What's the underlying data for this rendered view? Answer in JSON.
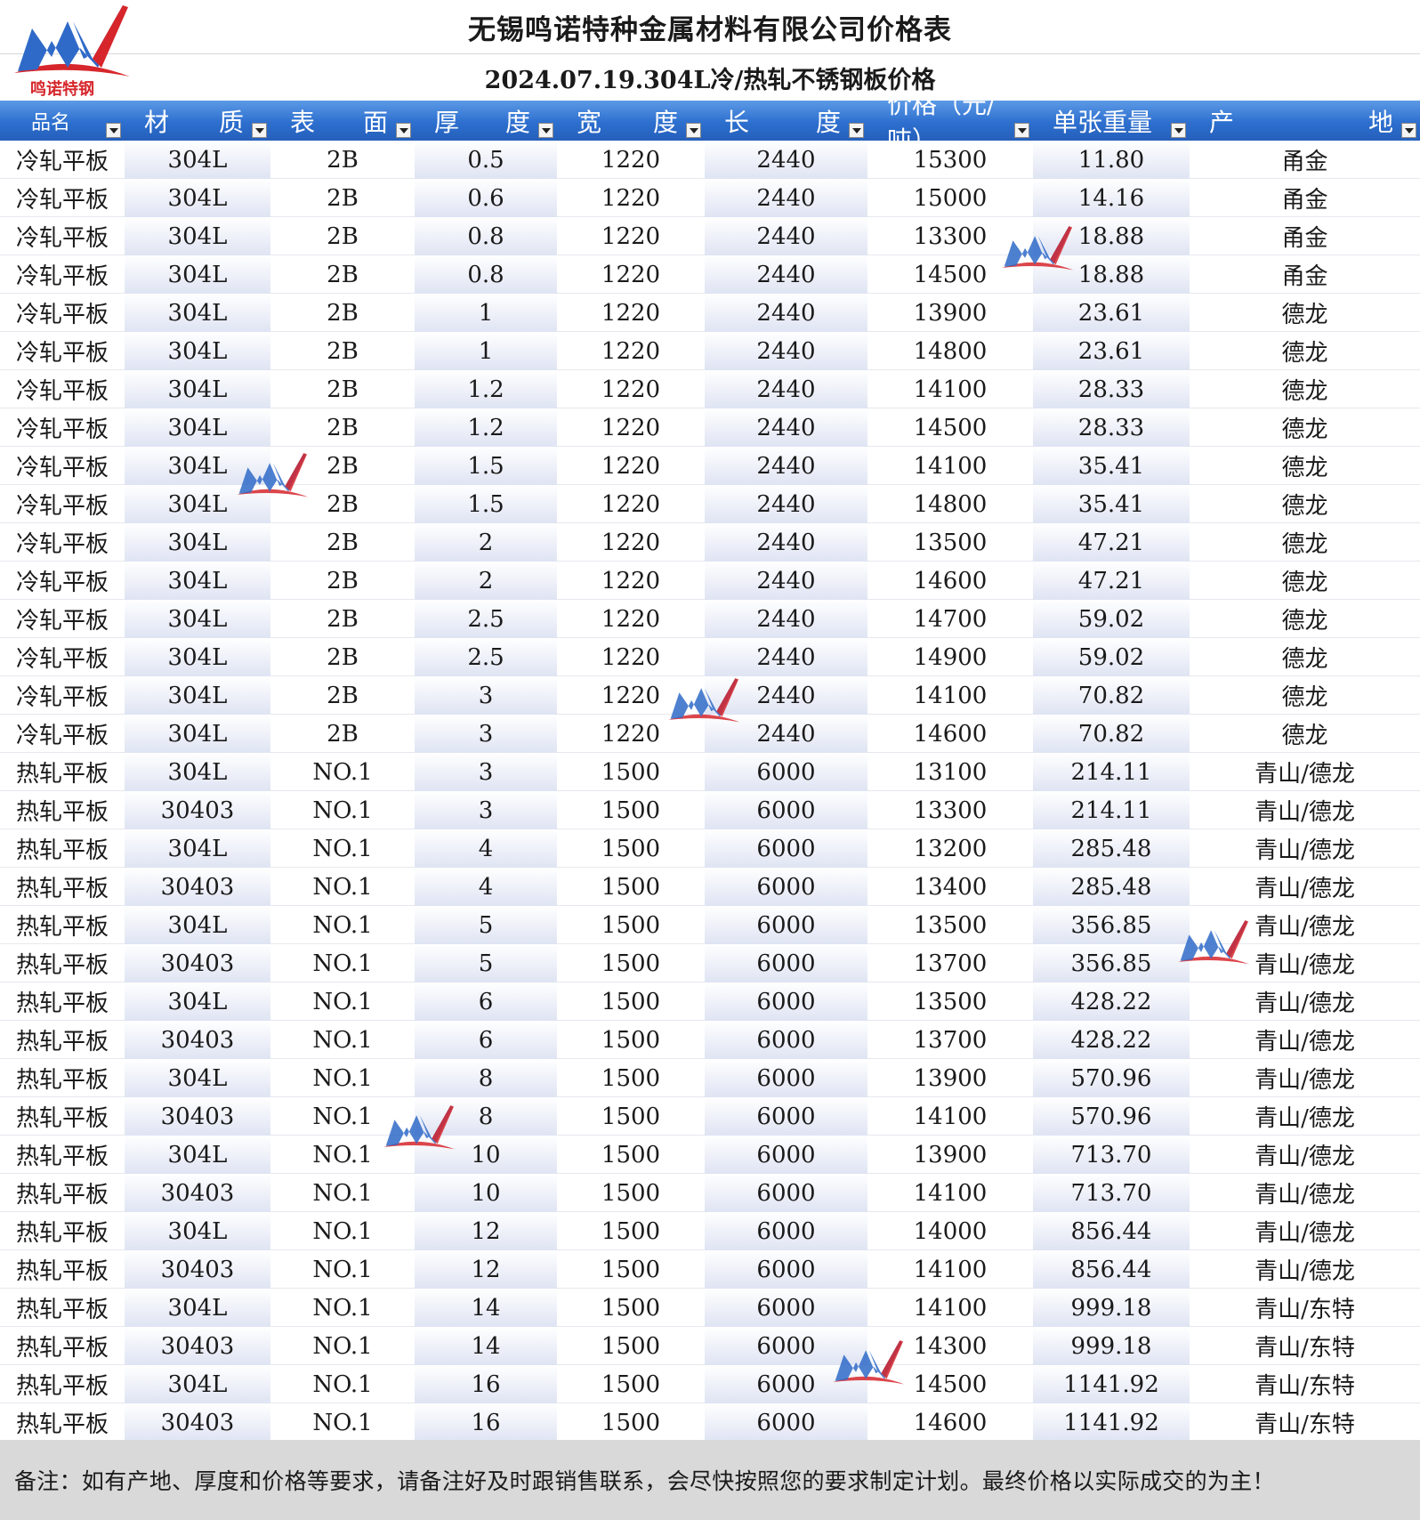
{
  "title": "无锡鸣诺特种金属材料有限公司价格表",
  "subtitle": "2024.07.19.304L冷/热轧不锈钢板价格",
  "logo": {
    "text": "鸣诺特钢",
    "icon": "company-logo-icon",
    "colors": {
      "red": "#d6262b",
      "blue": "#2f6ac8"
    }
  },
  "header_color": "#2d6fcf",
  "headers": [
    {
      "a": "品名",
      "b": ""
    },
    {
      "a": "材",
      "b": "质"
    },
    {
      "a": "表",
      "b": "面"
    },
    {
      "a": "厚",
      "b": "度"
    },
    {
      "a": "宽",
      "b": "度"
    },
    {
      "a": "长",
      "b": "度"
    },
    {
      "a": "价格（元/吨）",
      "b": ""
    },
    {
      "a": "单张重量",
      "b": ""
    },
    {
      "a": "产",
      "b": "地"
    }
  ],
  "rows": [
    [
      "冷轧平板",
      "304L",
      "2B",
      "0.5",
      "1220",
      "2440",
      "15300",
      "11.80",
      "甬金"
    ],
    [
      "冷轧平板",
      "304L",
      "2B",
      "0.6",
      "1220",
      "2440",
      "15000",
      "14.16",
      "甬金"
    ],
    [
      "冷轧平板",
      "304L",
      "2B",
      "0.8",
      "1220",
      "2440",
      "13300",
      "18.88",
      "甬金"
    ],
    [
      "冷轧平板",
      "304L",
      "2B",
      "0.8",
      "1220",
      "2440",
      "14500",
      "18.88",
      "甬金"
    ],
    [
      "冷轧平板",
      "304L",
      "2B",
      "1",
      "1220",
      "2440",
      "13900",
      "23.61",
      "德龙"
    ],
    [
      "冷轧平板",
      "304L",
      "2B",
      "1",
      "1220",
      "2440",
      "14800",
      "23.61",
      "德龙"
    ],
    [
      "冷轧平板",
      "304L",
      "2B",
      "1.2",
      "1220",
      "2440",
      "14100",
      "28.33",
      "德龙"
    ],
    [
      "冷轧平板",
      "304L",
      "2B",
      "1.2",
      "1220",
      "2440",
      "14500",
      "28.33",
      "德龙"
    ],
    [
      "冷轧平板",
      "304L",
      "2B",
      "1.5",
      "1220",
      "2440",
      "14100",
      "35.41",
      "德龙"
    ],
    [
      "冷轧平板",
      "304L",
      "2B",
      "1.5",
      "1220",
      "2440",
      "14800",
      "35.41",
      "德龙"
    ],
    [
      "冷轧平板",
      "304L",
      "2B",
      "2",
      "1220",
      "2440",
      "13500",
      "47.21",
      "德龙"
    ],
    [
      "冷轧平板",
      "304L",
      "2B",
      "2",
      "1220",
      "2440",
      "14600",
      "47.21",
      "德龙"
    ],
    [
      "冷轧平板",
      "304L",
      "2B",
      "2.5",
      "1220",
      "2440",
      "14700",
      "59.02",
      "德龙"
    ],
    [
      "冷轧平板",
      "304L",
      "2B",
      "2.5",
      "1220",
      "2440",
      "14900",
      "59.02",
      "德龙"
    ],
    [
      "冷轧平板",
      "304L",
      "2B",
      "3",
      "1220",
      "2440",
      "14100",
      "70.82",
      "德龙"
    ],
    [
      "冷轧平板",
      "304L",
      "2B",
      "3",
      "1220",
      "2440",
      "14600",
      "70.82",
      "德龙"
    ],
    [
      "热轧平板",
      "304L",
      "NO.1",
      "3",
      "1500",
      "6000",
      "13100",
      "214.11",
      "青山/德龙"
    ],
    [
      "热轧平板",
      "30403",
      "NO.1",
      "3",
      "1500",
      "6000",
      "13300",
      "214.11",
      "青山/德龙"
    ],
    [
      "热轧平板",
      "304L",
      "NO.1",
      "4",
      "1500",
      "6000",
      "13200",
      "285.48",
      "青山/德龙"
    ],
    [
      "热轧平板",
      "30403",
      "NO.1",
      "4",
      "1500",
      "6000",
      "13400",
      "285.48",
      "青山/德龙"
    ],
    [
      "热轧平板",
      "304L",
      "NO.1",
      "5",
      "1500",
      "6000",
      "13500",
      "356.85",
      "青山/德龙"
    ],
    [
      "热轧平板",
      "30403",
      "NO.1",
      "5",
      "1500",
      "6000",
      "13700",
      "356.85",
      "青山/德龙"
    ],
    [
      "热轧平板",
      "304L",
      "NO.1",
      "6",
      "1500",
      "6000",
      "13500",
      "428.22",
      "青山/德龙"
    ],
    [
      "热轧平板",
      "30403",
      "NO.1",
      "6",
      "1500",
      "6000",
      "13700",
      "428.22",
      "青山/德龙"
    ],
    [
      "热轧平板",
      "304L",
      "NO.1",
      "8",
      "1500",
      "6000",
      "13900",
      "570.96",
      "青山/德龙"
    ],
    [
      "热轧平板",
      "30403",
      "NO.1",
      "8",
      "1500",
      "6000",
      "14100",
      "570.96",
      "青山/德龙"
    ],
    [
      "热轧平板",
      "304L",
      "NO.1",
      "10",
      "1500",
      "6000",
      "13900",
      "713.70",
      "青山/德龙"
    ],
    [
      "热轧平板",
      "30403",
      "NO.1",
      "10",
      "1500",
      "6000",
      "14100",
      "713.70",
      "青山/德龙"
    ],
    [
      "热轧平板",
      "304L",
      "NO.1",
      "12",
      "1500",
      "6000",
      "14000",
      "856.44",
      "青山/德龙"
    ],
    [
      "热轧平板",
      "30403",
      "NO.1",
      "12",
      "1500",
      "6000",
      "14100",
      "856.44",
      "青山/德龙"
    ],
    [
      "热轧平板",
      "304L",
      "NO.1",
      "14",
      "1500",
      "6000",
      "14100",
      "999.18",
      "青山/东特"
    ],
    [
      "热轧平板",
      "30403",
      "NO.1",
      "14",
      "1500",
      "6000",
      "14300",
      "999.18",
      "青山/东特"
    ],
    [
      "热轧平板",
      "304L",
      "NO.1",
      "16",
      "1500",
      "6000",
      "14500",
      "1141.92",
      "青山/东特"
    ],
    [
      "热轧平板",
      "30403",
      "NO.1",
      "16",
      "1500",
      "6000",
      "14600",
      "1141.92",
      "青山/东特"
    ]
  ],
  "footer": "备注：如有产地、厚度和价格等要求，请备注好及时跟销售联系，会尽快按照您的要求制定计划。最终价格以实际成交的为主！"
}
